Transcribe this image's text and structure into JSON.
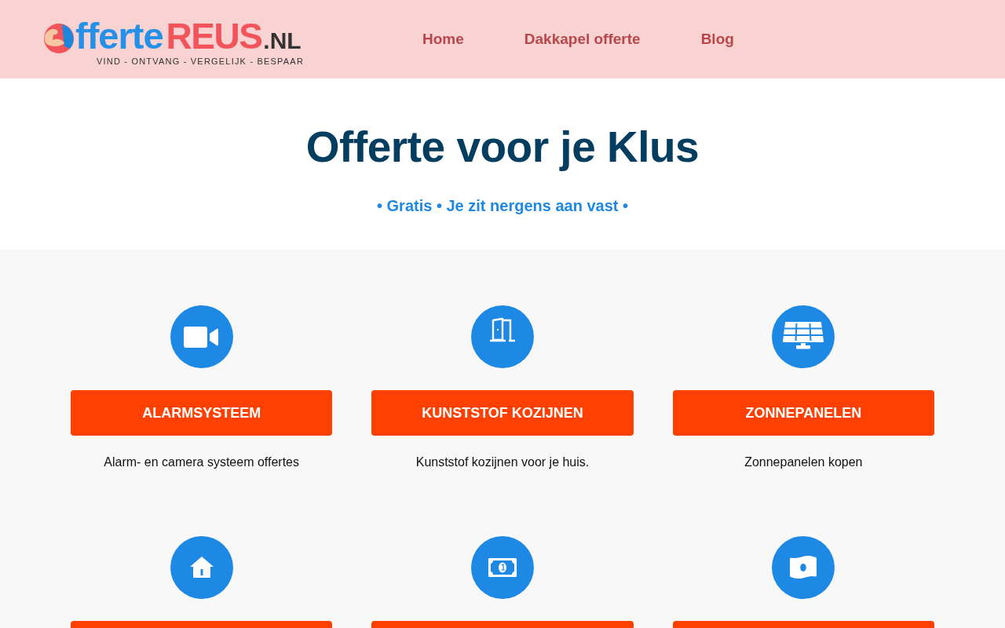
{
  "header": {
    "logo": {
      "word": "fferte",
      "brand": "REUS",
      "domain": ".NL",
      "tagline": "VIND - ONTVANG - VERGELIJK - BESPAAR"
    },
    "nav": [
      {
        "label": "Home"
      },
      {
        "label": "Dakkapel offerte"
      },
      {
        "label": "Blog"
      }
    ]
  },
  "hero": {
    "title": "Offerte voor je Klus",
    "subtitle": "• Gratis • Je zit nergens aan vast •"
  },
  "services": [
    {
      "title": "ALARMSYSTEEM",
      "description": "Alarm- en camera systeem offertes",
      "cut_off": false
    },
    {
      "title": "KUNSTSTOF KOZIJNEN",
      "description": "Kunststof kozijnen voor je huis.",
      "cut_off": false
    },
    {
      "title": "ZONNEPANELEN",
      "description": "Zonnepanelen kopen",
      "cut_off": false
    },
    {
      "cut_off": true
    },
    {
      "cut_off": true
    },
    {
      "cut_off": true
    }
  ]
}
